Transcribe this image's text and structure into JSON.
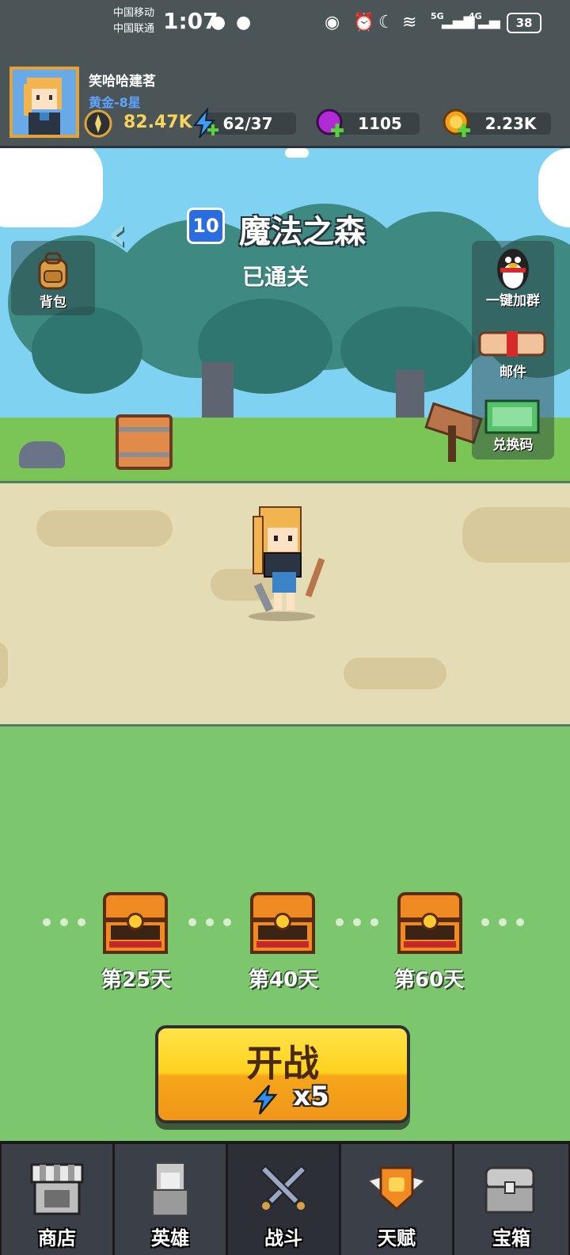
{
  "status_bar": {
    "carrier1": "中国移动",
    "carrier2": "中国联通",
    "time": "1:07",
    "net1": "5G",
    "net2": "4G",
    "battery": "38"
  },
  "player": {
    "name": "笑哈哈建茗",
    "rank": "黄金-8星",
    "power": "82.47K",
    "energy": "62/37",
    "gems": "1105",
    "gold": "2.23K"
  },
  "stage": {
    "number": "10",
    "name": "魔法之森",
    "status": "已通关"
  },
  "side_buttons": {
    "bag": "背包",
    "group": "一键加群",
    "mail": "邮件",
    "code": "兑换码"
  },
  "chests": [
    {
      "label": "第25天"
    },
    {
      "label": "第40天"
    },
    {
      "label": "第60天"
    }
  ],
  "start": {
    "label": "开战",
    "cost": "x5"
  },
  "nav": [
    {
      "label": "商店"
    },
    {
      "label": "英雄"
    },
    {
      "label": "战斗"
    },
    {
      "label": "天赋"
    },
    {
      "label": "宝箱"
    }
  ],
  "colors": {
    "header_bg": "#4b5558",
    "sky": "#7fd2f2",
    "field": "#7cc66d",
    "road": "#e4dcb4",
    "start_button": "#ffd21e",
    "rank_text": "#5fa5ff",
    "gem": "#b02bd6",
    "gold": "#f3a21a"
  }
}
